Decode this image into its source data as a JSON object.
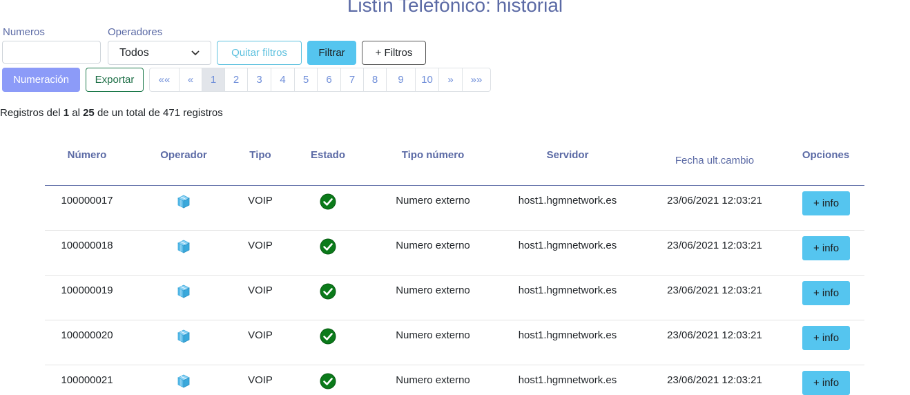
{
  "page": {
    "title": "Listín Telefónico: historial"
  },
  "filters": {
    "numeros_label": "Numeros",
    "numeros_value": "",
    "operadores_label": "Operadores",
    "operadores_selected": "Todos",
    "quitar_label": "Quitar filtros",
    "filtrar_label": "Filtrar",
    "mas_filtros_label": "+ Filtros"
  },
  "actions": {
    "numeracion_label": "Numeración",
    "exportar_label": "Exportar"
  },
  "pagination": {
    "items": [
      "««",
      "«",
      "1",
      "2",
      "3",
      "4",
      "5",
      "6",
      "7",
      "8",
      "9",
      "10",
      "»",
      "»»"
    ],
    "active": "1"
  },
  "records": {
    "prefix": "Registros del",
    "from": "1",
    "mid": "al",
    "to": "25",
    "suffix": "de un total de 471 registros"
  },
  "table": {
    "headers": {
      "numero": "Número",
      "operador": "Operador",
      "tipo": "Tipo",
      "estado": "Estado",
      "tipo_numero": "Tipo número",
      "servidor": "Servidor",
      "fecha": "Fecha ult.cambio",
      "opciones": "Opciones"
    },
    "rows": [
      {
        "numero": "100000017",
        "operador_icon": "cube-icon",
        "tipo": "VOIP",
        "estado_icon": "check-circle-icon",
        "tipo_numero": "Numero externo",
        "servidor": "host1.hgmnetwork.es",
        "fecha": "23/06/2021 12:03:21",
        "info_label": "+ info"
      },
      {
        "numero": "100000018",
        "operador_icon": "cube-icon",
        "tipo": "VOIP",
        "estado_icon": "check-circle-icon",
        "tipo_numero": "Numero externo",
        "servidor": "host1.hgmnetwork.es",
        "fecha": "23/06/2021 12:03:21",
        "info_label": "+ info"
      },
      {
        "numero": "100000019",
        "operador_icon": "cube-icon",
        "tipo": "VOIP",
        "estado_icon": "check-circle-icon",
        "tipo_numero": "Numero externo",
        "servidor": "host1.hgmnetwork.es",
        "fecha": "23/06/2021 12:03:21",
        "info_label": "+ info"
      },
      {
        "numero": "100000020",
        "operador_icon": "cube-icon",
        "tipo": "VOIP",
        "estado_icon": "check-circle-icon",
        "tipo_numero": "Numero externo",
        "servidor": "host1.hgmnetwork.es",
        "fecha": "23/06/2021 12:03:21",
        "info_label": "+ info"
      },
      {
        "numero": "100000021",
        "operador_icon": "cube-icon",
        "tipo": "VOIP",
        "estado_icon": "check-circle-icon",
        "tipo_numero": "Numero externo",
        "servidor": "host1.hgmnetwork.es",
        "fecha": "23/06/2021 12:03:21",
        "info_label": "+ info"
      }
    ]
  },
  "colors": {
    "accent": "#5b6aa5",
    "info": "#55c5ef",
    "primary_button": "#8c9bf8",
    "success": "#1e6f47",
    "check": "#0b7a1a"
  }
}
